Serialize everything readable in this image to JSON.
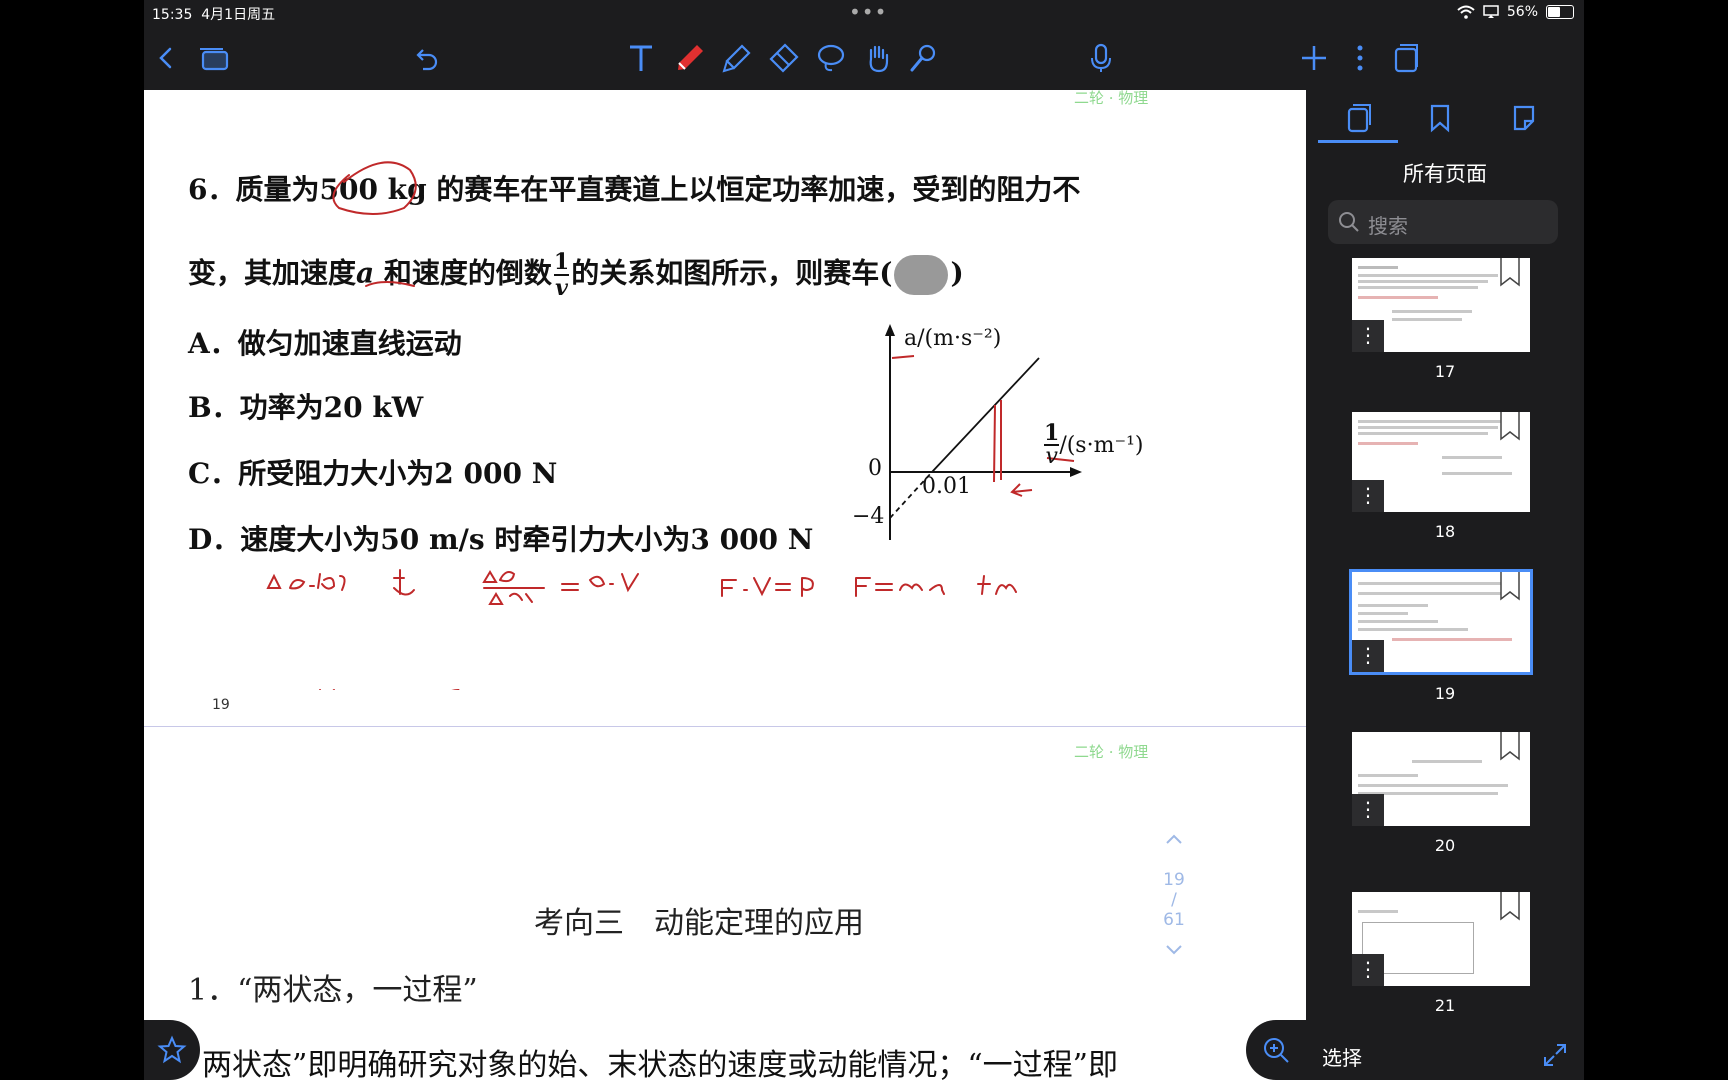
{
  "status": {
    "time": "15:35",
    "date": "4月1日周五",
    "battery": "56%",
    "battery_level": 0.56
  },
  "toolbar": {
    "left_icons": [
      "back-icon",
      "pages-icon",
      "undo-icon"
    ],
    "center_icons": [
      "text-tool-icon",
      "pen-tool-icon",
      "highlighter-icon",
      "eraser-icon",
      "lasso-icon",
      "hand-icon",
      "laser-icon"
    ],
    "right_icons": [
      "microphone-icon",
      "add-icon",
      "more-icon",
      "share-icon"
    ],
    "accent": "#e03030"
  },
  "doc": {
    "header_tag": "二轮 · 物理",
    "question_line1": "6．质量为500 kg 的赛车在平直赛道上以恒定功率加速，受到的阻力不",
    "question_line2_a": "变，其加速度",
    "question_line2_var": "a",
    "question_line2_b": " 和速度的倒数",
    "question_line2_frac_num": "1",
    "question_line2_frac_den": "v",
    "question_line2_c": "的关系如图所示，则赛车(",
    "question_line2_end": ")",
    "options": [
      "A．做匀加速直线运动",
      "B．功率为20 kW",
      "C．所受阻力大小为2 000 N",
      "D．速度大小为50 m/s 时牵引力大小为3 000 N"
    ],
    "graph": {
      "y_axis_label": "a/(m·s⁻²)",
      "x_axis_num": "1",
      "x_axis_den": "v",
      "x_axis_unit": "/(s·m⁻¹)",
      "origin": "0",
      "x_tick": "0.01",
      "y_tick": "−4"
    },
    "page_number": "19",
    "header_tag_2": "二轮 · 物理",
    "section_title": "考向三　动能定理的应用",
    "section_subtitle": "1．“两状态，一过程”",
    "section_body": "两状态”即明确研究对象的始、末状态的速度或动能情况；“一过程”即"
  },
  "pager": {
    "current": "19",
    "sep": "/",
    "total": "61"
  },
  "sidebar": {
    "title": "所有页面",
    "search_placeholder": "搜索",
    "thumbnails": [
      {
        "label": "17"
      },
      {
        "label": "18"
      },
      {
        "label": "19",
        "selected": true
      },
      {
        "label": "20"
      },
      {
        "label": "21"
      }
    ],
    "select_label": "选择"
  }
}
